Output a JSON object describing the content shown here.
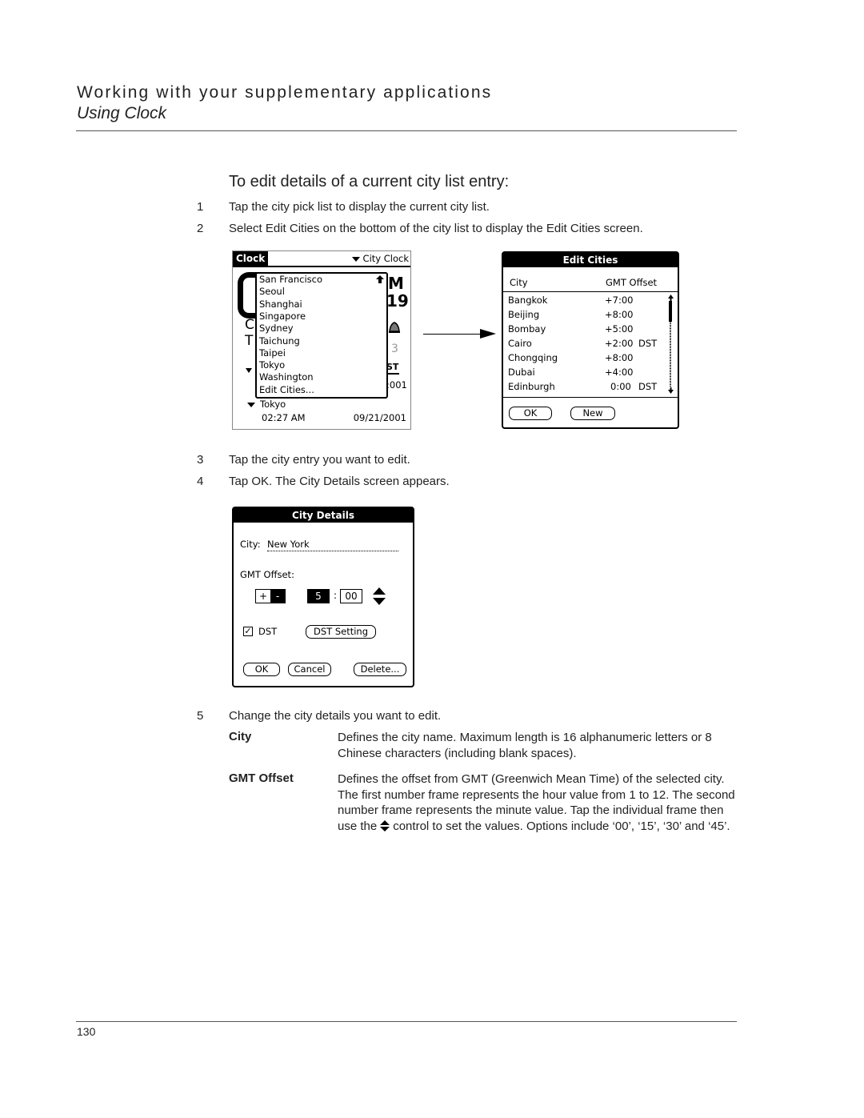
{
  "header": {
    "title": "Working with your supplementary applications",
    "subtitle": "Using Clock"
  },
  "section": {
    "title": "To edit details of a current city list entry:"
  },
  "steps": [
    {
      "num": "1",
      "text": "Tap the city pick list to display the current city list."
    },
    {
      "num": "2",
      "text": "Select Edit Cities on the bottom of the city list to display the Edit Cities screen."
    },
    {
      "num": "3",
      "text": "Tap the city entry you want to edit."
    },
    {
      "num": "4",
      "text": "Tap OK. The City Details screen appears."
    },
    {
      "num": "5",
      "text": "Change the city details you want to edit."
    }
  ],
  "clock_screen": {
    "tab_label": "Clock",
    "picker_label": "City Clock",
    "popup_items": [
      "San Francisco",
      "Seoul",
      "Shanghai",
      "Singapore",
      "Sydney",
      "Taichung",
      "Taipei",
      "Tokyo",
      "Washington",
      "Edit Cities..."
    ],
    "city": "Tokyo",
    "time": "02:27 AM",
    "date": "09/21/2001",
    "bg_fragments": {
      "m": "M",
      "nine": "19",
      "c": "C",
      "t": "T",
      "three": "3",
      "year": ":001"
    }
  },
  "edit_cities": {
    "title": "Edit Cities",
    "col_city": "City",
    "col_offset": "GMT Offset",
    "rows": [
      {
        "city": "Bangkok",
        "offset": "+7:00",
        "dst": ""
      },
      {
        "city": "Beijing",
        "offset": "+8:00",
        "dst": ""
      },
      {
        "city": "Bombay",
        "offset": "+5:00",
        "dst": ""
      },
      {
        "city": "Cairo",
        "offset": "+2:00",
        "dst": "DST"
      },
      {
        "city": "Chongqing",
        "offset": "+8:00",
        "dst": ""
      },
      {
        "city": "Dubai",
        "offset": "+4:00",
        "dst": ""
      },
      {
        "city": "Edinburgh",
        "offset": "0:00",
        "dst": "DST"
      }
    ],
    "ok_label": "OK",
    "new_label": "New"
  },
  "city_details": {
    "title": "City Details",
    "city_label": "City:",
    "city_value": "New York",
    "offset_label": "GMT Offset:",
    "plus": "+",
    "minus": "-",
    "hour": "5",
    "colon": ":",
    "minute": "00",
    "dst_label": "DST",
    "dst_checked": true,
    "dst_check_glyph": "✓",
    "dst_setting_label": "DST Setting",
    "ok_label": "OK",
    "cancel_label": "Cancel",
    "delete_label": "Delete..."
  },
  "definitions": [
    {
      "term": "City",
      "text": "Defines the city name. Maximum length is 16 alphanumeric letters or 8 Chinese characters (including blank spaces)."
    },
    {
      "term": "GMT Offset",
      "text_before": "Defines the offset from GMT (Greenwich Mean Time) of the selected city. The first number frame represents the hour value from 1 to 12. The second number frame represents the minute value. Tap the individual frame then use the",
      "text_after": "control to set the values. Options include ‘00’, ‘15’, ‘30’ and ‘45’."
    }
  ],
  "footer": {
    "page_number": "130"
  }
}
